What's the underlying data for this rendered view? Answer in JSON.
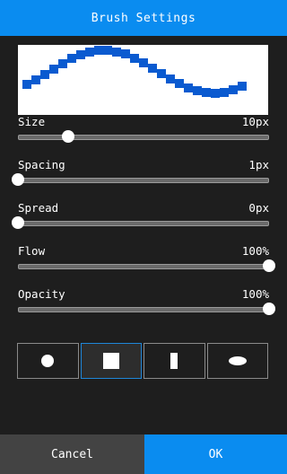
{
  "dialog": {
    "title": "Brush Settings"
  },
  "preview": {
    "stroke_color": "#0a5ad0"
  },
  "settings": [
    {
      "label": "Size",
      "value": "10px",
      "level": 0.2
    },
    {
      "label": "Spacing",
      "value": "1px",
      "level": 0.0
    },
    {
      "label": "Spread",
      "value": "0px",
      "level": 0.0
    },
    {
      "label": "Flow",
      "value": "100%",
      "level": 1.0
    },
    {
      "label": "Opacity",
      "value": "100%",
      "level": 1.0
    }
  ],
  "shapes": {
    "items": [
      {
        "icon": "circle-shape-icon"
      },
      {
        "icon": "square-shape-icon"
      },
      {
        "icon": "vertical-bar-shape-icon"
      },
      {
        "icon": "ellipse-shape-icon"
      }
    ],
    "selected_index": 1
  },
  "footer": {
    "cancel_label": "Cancel",
    "ok_label": "OK"
  },
  "colors": {
    "accent": "#0a8cf0",
    "background": "#1e1e1e",
    "cancel_bg": "#434343"
  }
}
